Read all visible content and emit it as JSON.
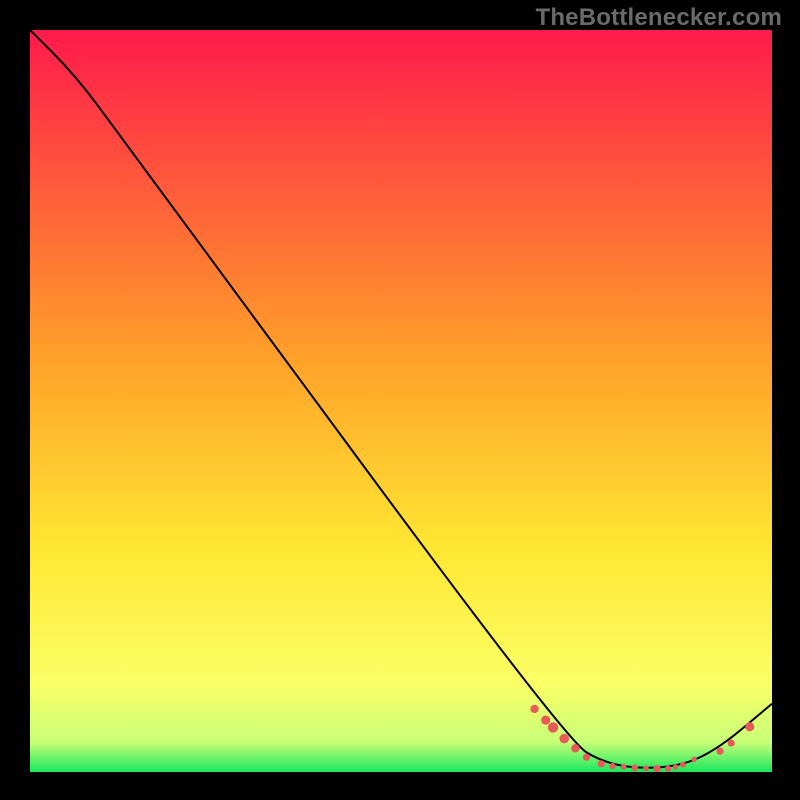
{
  "attribution": "TheBottlenecker.com",
  "chart_data": {
    "type": "line",
    "title": "",
    "xlabel": "",
    "ylabel": "",
    "xlim": [
      0,
      100
    ],
    "ylim": [
      0,
      100
    ],
    "background_gradient_stops": [
      {
        "y": 100,
        "color": "#ff1a4b"
      },
      {
        "y": 55,
        "color": "#ffa329"
      },
      {
        "y": 30,
        "color": "#ffe733"
      },
      {
        "y": 12,
        "color": "#fbff66"
      },
      {
        "y": 4,
        "color": "#c8ff78"
      },
      {
        "y": 0,
        "color": "#18e85e"
      }
    ],
    "curve": [
      {
        "x": 0,
        "y": 100
      },
      {
        "x": 6,
        "y": 94
      },
      {
        "x": 12,
        "y": 86
      },
      {
        "x": 72,
        "y": 4.5
      },
      {
        "x": 78,
        "y": 0.8
      },
      {
        "x": 86,
        "y": 0.4
      },
      {
        "x": 92,
        "y": 2.5
      },
      {
        "x": 100,
        "y": 9.2
      }
    ],
    "markers": [
      {
        "x": 68,
        "y": 8.5,
        "r": 4.2
      },
      {
        "x": 69.5,
        "y": 7.0,
        "r": 4.6
      },
      {
        "x": 70.5,
        "y": 6.0,
        "r": 5.2
      },
      {
        "x": 72,
        "y": 4.5,
        "r": 4.8
      },
      {
        "x": 73.5,
        "y": 3.2,
        "r": 4.2
      },
      {
        "x": 75,
        "y": 2.0,
        "r": 3.6
      },
      {
        "x": 77,
        "y": 1.1,
        "r": 3.6
      },
      {
        "x": 78.5,
        "y": 0.8,
        "r": 3.2
      },
      {
        "x": 80,
        "y": 0.7,
        "r": 2.9
      },
      {
        "x": 81.5,
        "y": 0.55,
        "r": 3.4
      },
      {
        "x": 83,
        "y": 0.5,
        "r": 2.9
      },
      {
        "x": 84.5,
        "y": 0.45,
        "r": 3.8
      },
      {
        "x": 86,
        "y": 0.45,
        "r": 3.2
      },
      {
        "x": 87,
        "y": 0.7,
        "r": 2.7
      },
      {
        "x": 88,
        "y": 1.0,
        "r": 3.0
      },
      {
        "x": 89.5,
        "y": 1.7,
        "r": 2.7
      },
      {
        "x": 93,
        "y": 2.8,
        "r": 3.6
      },
      {
        "x": 94.5,
        "y": 3.9,
        "r": 3.6
      },
      {
        "x": 97,
        "y": 6.1,
        "r": 4.6
      }
    ],
    "marker_color": "#e85a5a",
    "curve_color": "#000000"
  }
}
